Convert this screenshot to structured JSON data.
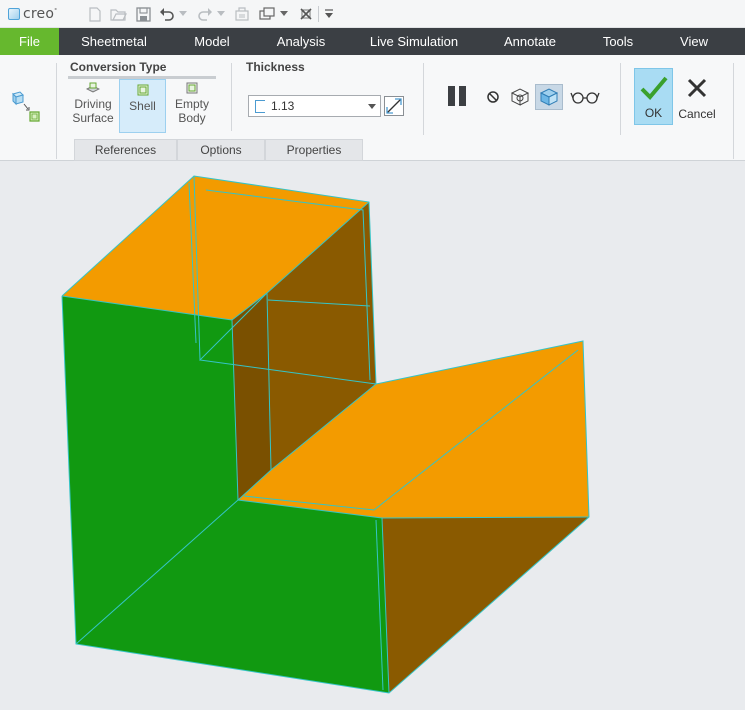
{
  "app": {
    "logo_text": "creo",
    "logo_mark": "°"
  },
  "quick_access": {
    "icons": [
      "new-file-icon",
      "open-file-icon",
      "save-icon",
      "undo-icon",
      "redo-icon",
      "regenerate-icon",
      "windows-icon",
      "close-window-icon",
      "customize-toolbar-icon"
    ]
  },
  "tabs": [
    "File",
    "Sheetmetal",
    "Model",
    "Analysis",
    "Live Simulation",
    "Annotate",
    "Tools",
    "View"
  ],
  "ribbon": {
    "conversion_type": {
      "title": "Conversion Type",
      "options": [
        {
          "label_line1": "Driving",
          "label_line2": "Surface",
          "selected": false
        },
        {
          "label_line1": "Shell",
          "label_line2": "",
          "selected": true
        },
        {
          "label_line1": "Empty",
          "label_line2": "Body",
          "selected": false
        }
      ]
    },
    "thickness": {
      "title": "Thickness",
      "value": "1.13"
    },
    "controls": {
      "pause": "pause-icon",
      "no_preview": "no-preview-icon",
      "preview": "preview-icon",
      "verify": "verify-icon",
      "glasses": "glasses-icon"
    },
    "ok_label": "OK",
    "cancel_label": "Cancel",
    "subtabs": [
      "References",
      "Options",
      "Properties"
    ]
  },
  "colors": {
    "file_tab": "#66b82e",
    "tabbar": "#3b3f44",
    "ok_highlight": "#a9dcf3",
    "model_top": "#f39b00",
    "model_side_dark": "#8a5a00",
    "model_green": "#119911",
    "edges": "#35c4c6",
    "viewport_bg": "#e9ebee"
  }
}
